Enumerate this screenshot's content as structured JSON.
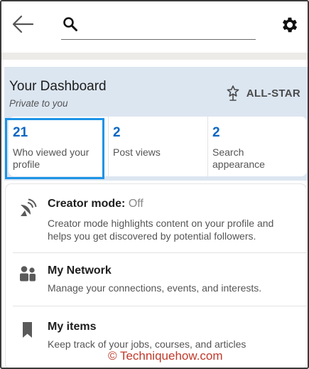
{
  "search": {
    "placeholder": ""
  },
  "dashboard": {
    "title": "Your Dashboard",
    "subtitle": "Private to you",
    "badge": "ALL-STAR",
    "stats": [
      {
        "value": "21",
        "label": "Who viewed your profile"
      },
      {
        "value": "2",
        "label": "Post views"
      },
      {
        "value": "2",
        "label": "Search appearance"
      }
    ]
  },
  "items": [
    {
      "icon": "satellite-dish-icon",
      "title": "Creator mode:",
      "status": "Off",
      "description": "Creator mode highlights content on your profile and helps you get discovered by potential followers."
    },
    {
      "icon": "people-icon",
      "title": "My Network",
      "description": "Manage your connections, events, and interests."
    },
    {
      "icon": "bookmark-icon",
      "title": "My items",
      "description": "Keep track of your jobs, courses, and articles"
    }
  ],
  "watermark": "© Techniquehow.com",
  "colors": {
    "accent": "#0a66c2",
    "highlight": "#1d93e6",
    "dashboard_bg": "#dce6f1",
    "watermark": "#c0392b"
  }
}
